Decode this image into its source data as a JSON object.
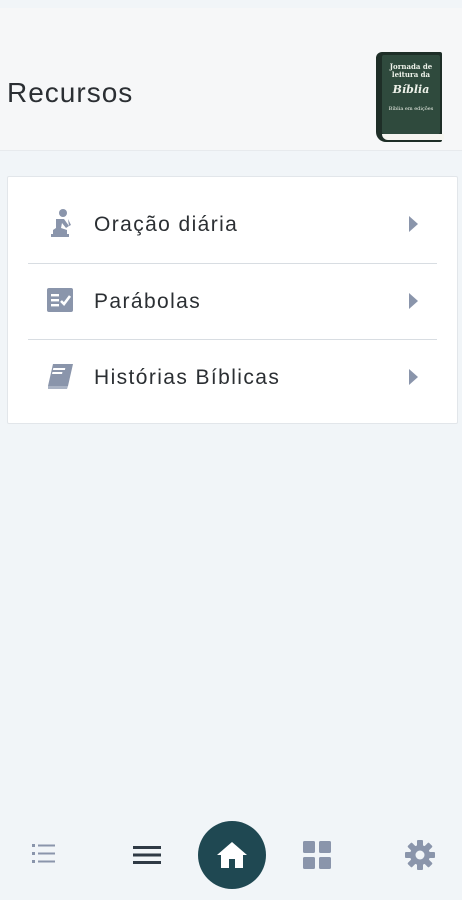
{
  "header": {
    "title": "Recursos",
    "logo": {
      "line1": "Jornada de",
      "line2": "leitura da",
      "line3": "Bíblia",
      "line4": "Bíblia em edições"
    }
  },
  "resources": {
    "items": [
      {
        "label": "Oração diária",
        "icon": "praying-person-icon"
      },
      {
        "label": "Parábolas",
        "icon": "checklist-icon"
      },
      {
        "label": "Histórias Bíblicas",
        "icon": "book-icon"
      }
    ]
  },
  "bottom_nav": {
    "items": [
      {
        "name": "list-icon"
      },
      {
        "name": "menu-icon"
      },
      {
        "name": "home-icon",
        "active": true
      },
      {
        "name": "grid-icon"
      },
      {
        "name": "settings-icon"
      }
    ]
  },
  "colors": {
    "accent": "#1f4852",
    "icon": "#8a95ab",
    "background": "#f1f5f8"
  }
}
